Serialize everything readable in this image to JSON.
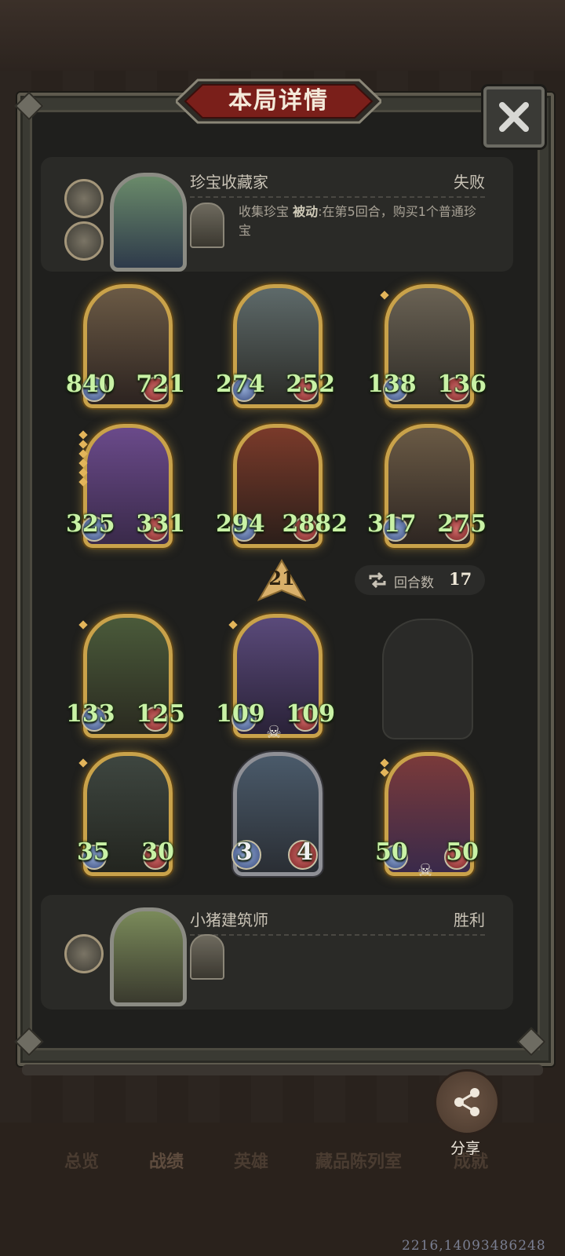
{
  "header": {
    "title": "本局详情"
  },
  "opponent": {
    "name": "珍宝收藏家",
    "result": "失败",
    "skill_name": "收集珍宝",
    "skill_type": "被动",
    "skill_desc": ":在第5回合，购买1个普通珍宝"
  },
  "player": {
    "name": "小猪建筑师",
    "result": "胜利"
  },
  "enemy_units": [
    {
      "atk": "840",
      "hp": "721"
    },
    {
      "atk": "274",
      "hp": "252"
    },
    {
      "atk": "138",
      "hp": "136"
    },
    {
      "atk": "325",
      "hp": "331"
    },
    {
      "atk": "294",
      "hp": "2882"
    },
    {
      "atk": "317",
      "hp": "275"
    }
  ],
  "level": "21",
  "rounds": {
    "label": "回合数",
    "value": "17"
  },
  "player_units": [
    {
      "atk": "133",
      "hp": "125"
    },
    {
      "atk": "109",
      "hp": "109"
    },
    {
      "atk": "35",
      "hp": "30"
    },
    {
      "atk": "3",
      "hp": "4"
    },
    {
      "atk": "50",
      "hp": "50"
    }
  ],
  "share": {
    "label": "分享"
  },
  "tabs": [
    "总览",
    "战绩",
    "英雄",
    "藏品陈列室",
    "成就"
  ],
  "footer_code": "2216,14093486248",
  "colors": {
    "stat_text": "#c9f2a6",
    "gold_border": "#c9a24a",
    "panel": "#1f1f1d"
  }
}
